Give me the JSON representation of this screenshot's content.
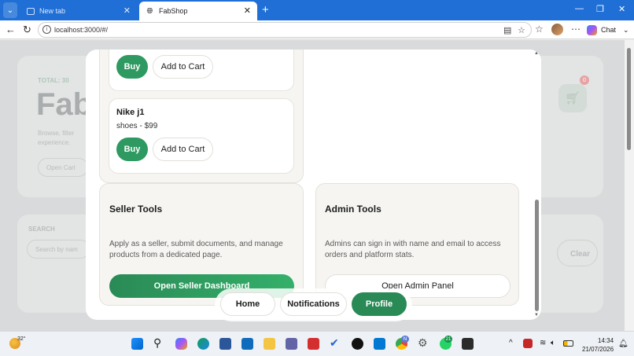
{
  "browser": {
    "tabs": [
      {
        "title": "New tab",
        "active": false
      },
      {
        "title": "FabShop",
        "active": true
      }
    ],
    "url": "localhost:3000/#/",
    "chat_label": "Chat"
  },
  "background": {
    "hero_kicker": "TOTAL: 30",
    "hero_title": "Fab",
    "hero_desc_1": "Browse, filter",
    "hero_desc_2": "experience.",
    "hero_button": "Open Cart",
    "cart_count": "0",
    "search_label": "SEARCH",
    "search_placeholder": "Search by nam",
    "clear_label": "Clear"
  },
  "products": [
    {
      "buy_label": "Buy",
      "cart_label": "Add to Cart"
    },
    {
      "name": "Nike j1",
      "meta": "shoes - $99",
      "buy_label": "Buy",
      "cart_label": "Add to Cart"
    }
  ],
  "seller_tools": {
    "title": "Seller Tools",
    "desc_1": "Apply as a seller, submit documents, and manage",
    "desc_2": "products from a dedicated page.",
    "button": "Open Seller Dashboard"
  },
  "admin_tools": {
    "title": "Admin Tools",
    "desc_1": "Admins can sign in with name and email to access",
    "desc_2": "orders and platform stats.",
    "button": "Open Admin Panel"
  },
  "bottom_nav": [
    {
      "label": "Home",
      "active": false
    },
    {
      "label": "Notifications",
      "active": false
    },
    {
      "label": "Profile",
      "active": true
    }
  ],
  "taskbar": {
    "temperature": "32°",
    "time": "14:34",
    "date": "21/07/2026",
    "badge_1": "N",
    "badge_2": "21"
  },
  "colors": {
    "accent_green": "#2e9960",
    "browser_blue": "#1f6fd6"
  }
}
